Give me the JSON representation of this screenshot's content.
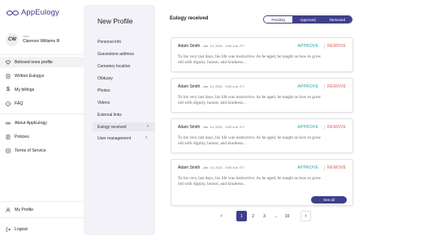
{
  "app": {
    "name": "AppEulogy"
  },
  "user": {
    "initials": "CW",
    "greeting": "Hello",
    "name": "Clarence Williams III"
  },
  "sidebar": {
    "items": [
      {
        "label": "Beloved ones profile",
        "icon": "heart-icon"
      },
      {
        "label": "Written Eulogys",
        "icon": "document-icon"
      },
      {
        "label": "My billings",
        "icon": "dollar-icon"
      },
      {
        "label": "FAQ",
        "icon": "help-icon"
      },
      {
        "label": "About AppEulogy",
        "icon": "infinity-icon"
      },
      {
        "label": "Policies",
        "icon": "policy-icon"
      },
      {
        "label": "Terms of Service",
        "icon": "terms-icon"
      },
      {
        "label": "My Profile",
        "icon": "person-icon"
      },
      {
        "label": "Logout",
        "icon": "logout-icon"
      }
    ]
  },
  "profile_panel": {
    "title": "New Profile",
    "items": [
      "Personal info",
      "Gravestone address",
      "Cemetery location",
      "Obituary",
      "Photos",
      "Videos",
      "External links",
      "Eulogy received",
      "User management"
    ]
  },
  "main": {
    "title": "Eulogy received",
    "tabs": [
      "Pending",
      "Approved",
      "Removed"
    ],
    "approve_label": "APPROVE",
    "remove_label": "REMOVE",
    "cards": [
      {
        "name": "Adam Smith",
        "date": " - Jan. 14, 2021 - 9:00 a.m. ET",
        "line1": "To his very last days, his life was instructive. As he aged, he taught us how to grow",
        "line2": "old with dignity, humor, and kindness..."
      },
      {
        "name": "Adam Smith",
        "date": " - Jan. 14, 2021 - 9:00 a.m. ET",
        "line1": "To his very last days, his life was instructive. As he aged, he taught us how to grow",
        "line2": "old with dignity, humor, and kindness..."
      },
      {
        "name": "Adam Smith",
        "date": " - Jan. 14, 2021 - 9:00 a.m. ET",
        "line1": "To his very last days, his life was instructive. As he aged, he taught us how to grow",
        "line2": "old with dignity, humor, and kindness..."
      },
      {
        "name": "Adam Smith",
        "date": " - Jan. 14, 2021 - 9:00 a.m. ET",
        "line1": "To his very last days, his life was instructive. As he aged, he taught us how to grow",
        "line2": "old with dignity, humor, and kindness..."
      }
    ],
    "see_all": "See all"
  },
  "pagination": {
    "prev": "‹",
    "pages": [
      "1",
      "2",
      "3",
      "...",
      "10"
    ],
    "next": "›"
  },
  "colors": {
    "accent": "#3f3f8c",
    "approve": "#2e9e9e",
    "remove": "#e05a4f",
    "panel_bg": "#f2f2f8"
  }
}
